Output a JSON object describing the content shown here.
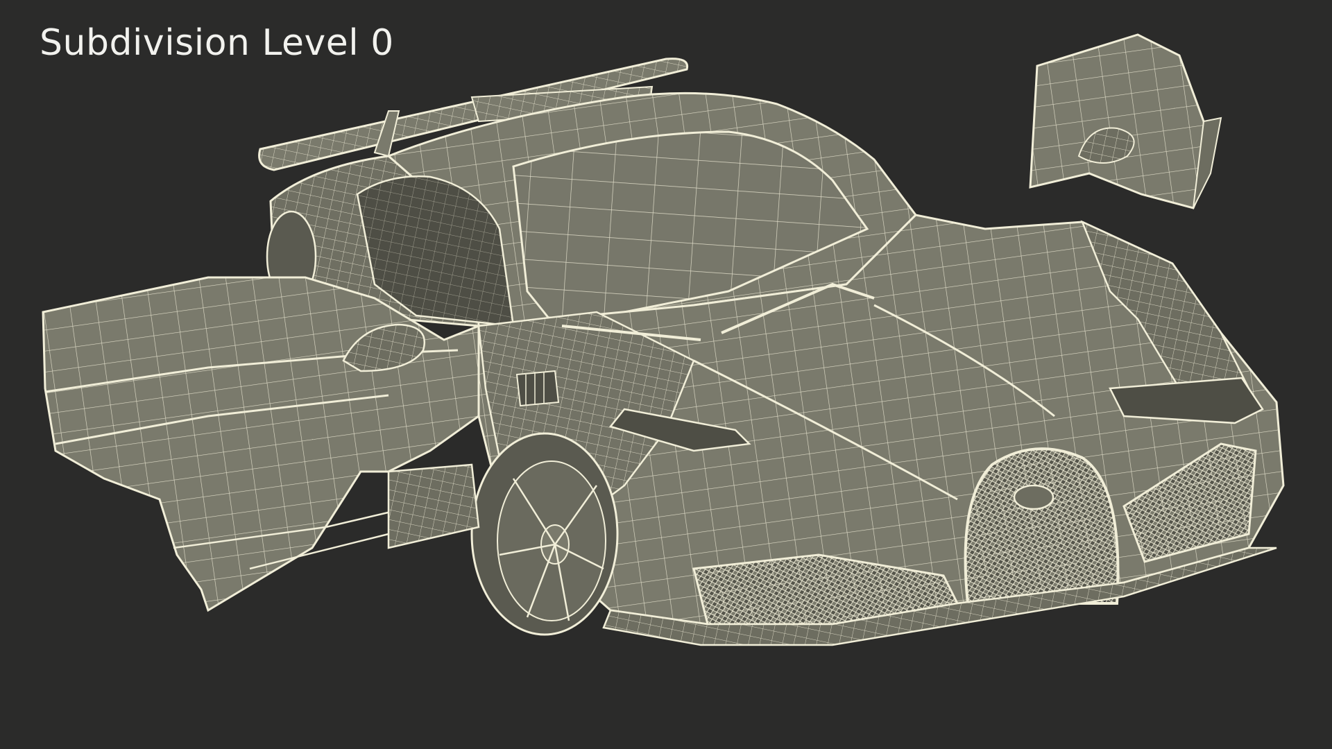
{
  "caption": "Subdivision Level 0",
  "colors": {
    "background": "#2b2b2a",
    "surface": "#7a7a6c",
    "surface_dark": "#5f5f54",
    "wire": "#f1eed8",
    "caption_text": "#f2f2ee"
  },
  "subject": "sports-car-wireframe-render"
}
